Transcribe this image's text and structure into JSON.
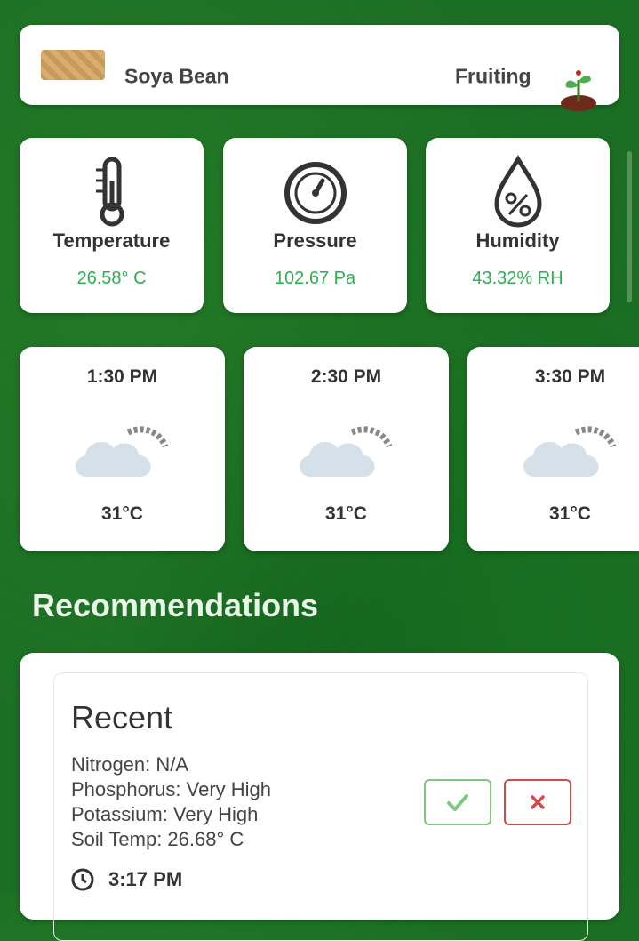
{
  "crop": {
    "name": "Soya Bean",
    "stage": "Fruiting",
    "thumb_icon": "crop-thumbnail",
    "stage_icon": "sprout-icon"
  },
  "sensors": [
    {
      "icon": "thermometer-icon",
      "label": "Temperature",
      "value": "26.58° C"
    },
    {
      "icon": "gauge-icon",
      "label": "Pressure",
      "value": "102.67 Pa"
    },
    {
      "icon": "humidity-drop-icon",
      "label": "Humidity",
      "value": "43.32% RH"
    }
  ],
  "forecast": [
    {
      "time": "1:30 PM",
      "icon": "cloud-sun-icon",
      "temp": "31°C"
    },
    {
      "time": "2:30 PM",
      "icon": "cloud-sun-icon",
      "temp": "31°C"
    },
    {
      "time": "3:30 PM",
      "icon": "cloud-sun-icon",
      "temp": "31°C"
    }
  ],
  "recommendations": {
    "section_title": "Recommendations",
    "card_title": "Recent",
    "lines": [
      "Nitrogen: N/A",
      "Phosphorus: Very High",
      "Potassium: Very High",
      "Soil Temp: 26.68° C"
    ],
    "time": "3:17 PM",
    "accept_icon": "check-icon",
    "reject_icon": "close-icon"
  },
  "colors": {
    "background": "#1c6e24",
    "value_green": "#2fae52",
    "accept": "#7dc77f",
    "reject": "#d24a4a"
  }
}
